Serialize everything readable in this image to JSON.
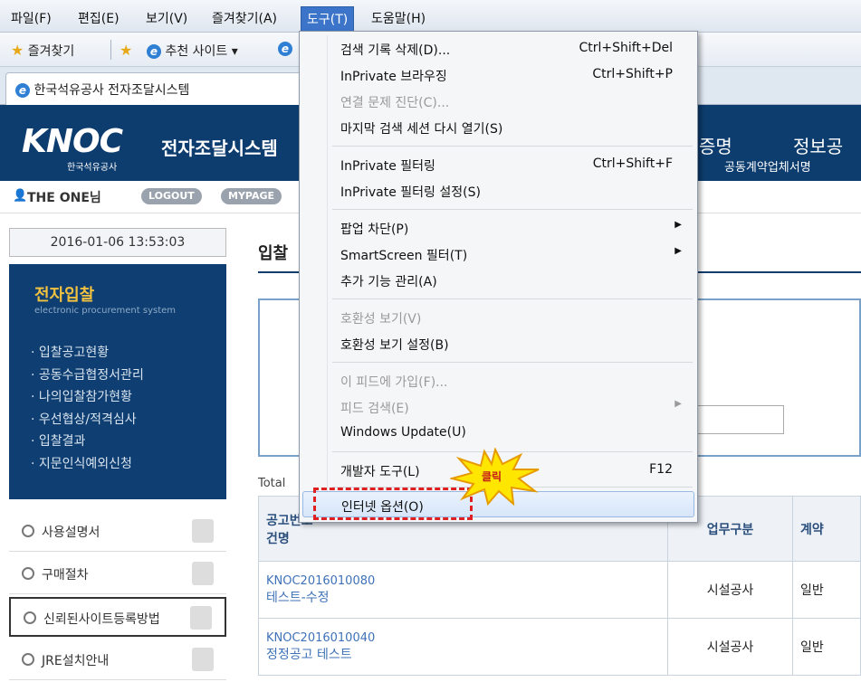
{
  "menubar": {
    "items": [
      "파일(F)",
      "편집(E)",
      "보기(V)",
      "즐겨찾기(A)",
      "도구(T)",
      "도움말(H)"
    ]
  },
  "favbar": {
    "favorites": "즐겨찾기",
    "suggested": "추천 사이트 ▾"
  },
  "tab": {
    "title": "한국석유공사 전자조달시스템"
  },
  "site": {
    "logo": "KNOC",
    "logo_sub": "한국석유공사",
    "system_title": "전자조달시스템",
    "nav_cert": "증명",
    "nav_info": "정보공",
    "nav_sub": "공동계약업체서명"
  },
  "userbar": {
    "username": "THE ONE님",
    "logout": "LOGOUT",
    "mypage": "MYPAGE"
  },
  "left": {
    "datetime": "2016-01-06 13:53:03",
    "bid_title": "전자입찰",
    "bid_sub": "electronic procurement system",
    "bid_items": [
      "· 입찰공고현황",
      "· 공동수급협정서관리",
      "· 나의입찰참가현황",
      "· 우선협상/적격심사",
      "· 입찰결과",
      "· 지문인식예외신청"
    ],
    "menus": [
      "사용설명서",
      "구매절차",
      "신뢰된사이트등록방법",
      "JRE설치안내"
    ]
  },
  "main": {
    "page_heading": "입찰",
    "total_label": "Total",
    "table": {
      "headers": [
        "공고번호\n건명",
        "업무구분",
        "계약"
      ],
      "rows": [
        {
          "no": "KNOC2016010080",
          "title": "테스트-수정",
          "type": "시설공사",
          "contract": "일반"
        },
        {
          "no": "KNOC2016010040",
          "title": "정정공고 테스트",
          "type": "시설공사",
          "contract": "일반"
        }
      ]
    }
  },
  "tools_menu": {
    "items": [
      {
        "label": "검색 기록 삭제(D)...",
        "shortcut": "Ctrl+Shift+Del"
      },
      {
        "label": "InPrivate 브라우징",
        "shortcut": "Ctrl+Shift+P"
      },
      {
        "label": "연결 문제 진단(C)...",
        "disabled": true
      },
      {
        "label": "마지막 검색 세션 다시 열기(S)"
      },
      {
        "label": "InPrivate 필터링",
        "shortcut": "Ctrl+Shift+F"
      },
      {
        "label": "InPrivate 필터링 설정(S)"
      },
      {
        "label": "팝업 차단(P)",
        "submenu": true
      },
      {
        "label": "SmartScreen 필터(T)",
        "submenu": true
      },
      {
        "label": "추가 기능 관리(A)"
      },
      {
        "label": "호환성 보기(V)",
        "disabled": true
      },
      {
        "label": "호환성 보기 설정(B)"
      },
      {
        "label": "이 피드에 가입(F)...",
        "disabled": true
      },
      {
        "label": "피드 검색(E)",
        "disabled": true,
        "submenu": true
      },
      {
        "label": "Windows Update(U)"
      },
      {
        "label": "개발자 도구(L)",
        "shortcut": "F12"
      },
      {
        "label": "인터넷 옵션(O)",
        "highlighted": true
      }
    ]
  },
  "annotation": {
    "click_label": "클릭"
  },
  "colors": {
    "site_navy": "#0d3c6e",
    "bid_title_yellow": "#f0c040",
    "menu_highlight": "#3b74c9",
    "annotation_red": "#e02020"
  }
}
